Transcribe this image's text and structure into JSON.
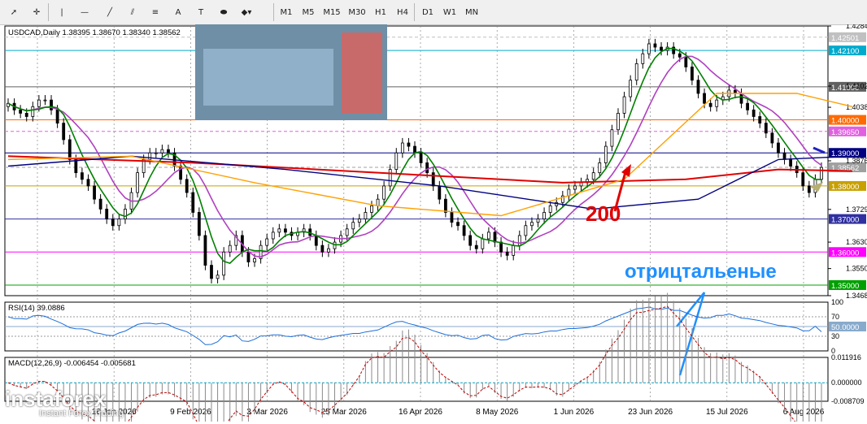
{
  "toolbar": {
    "timeframes": [
      "M1",
      "M5",
      "M15",
      "M30",
      "H1",
      "H4",
      "D1",
      "W1",
      "MN"
    ],
    "tools": [
      {
        "icon": "cursor-icon",
        "glyph": "➚"
      },
      {
        "icon": "crosshair-icon",
        "glyph": "✛"
      },
      {
        "icon": "vertical-line-icon",
        "glyph": "|"
      },
      {
        "icon": "horizontal-line-icon",
        "glyph": "—"
      },
      {
        "icon": "trend-line-icon",
        "glyph": "╱"
      },
      {
        "icon": "equidistant-channel-icon",
        "glyph": "⫽"
      },
      {
        "icon": "fibonacci-icon",
        "glyph": "≡"
      },
      {
        "icon": "text-icon",
        "glyph": "A"
      },
      {
        "icon": "text-label-icon",
        "glyph": "T"
      },
      {
        "icon": "arrows-icon",
        "glyph": "⬬"
      },
      {
        "icon": "objects-dropdown-icon",
        "glyph": "◆▾"
      }
    ]
  },
  "chart_data": {
    "type": "candlestick",
    "symbol_header": "USDCAD,Daily  1.38395 1.38670 1.38340 1.38562",
    "x_labels": [
      "16 Jan 2026",
      "9 Feb 2026",
      "3 Mar 2026",
      "25 Mar 2026",
      "16 Apr 2026",
      "8 May 2026",
      "1 Jun 2026",
      "23 Jun 2026",
      "15 Jul 2026",
      "6 Aug 2026"
    ],
    "price_range": [
      1.3468,
      1.4284
    ],
    "y_ticks": [
      "1.42840",
      "1.41020",
      "1.40380",
      "1.38760",
      "1.37290",
      "1.36300",
      "1.35500",
      "1.34680"
    ],
    "price_levels": [
      {
        "label": "1.42501",
        "value": 1.42501,
        "color": "#c0c0c0",
        "style": "dashed"
      },
      {
        "label": "1.42100",
        "value": 1.421,
        "color": "#00aacc",
        "style": "solid"
      },
      {
        "label": "1.41000",
        "value": 1.41,
        "color": "#606060",
        "style": "solid"
      },
      {
        "label": "1.40000",
        "value": 1.4,
        "color": "#ff6a00",
        "style": "solid"
      },
      {
        "label": "1.39650",
        "value": 1.3965,
        "color": "#e060e0",
        "style": "dashed"
      },
      {
        "label": "1.39000",
        "value": 1.39,
        "color": "#000080",
        "style": "solid"
      },
      {
        "label": "1.38562",
        "value": 1.38562,
        "color": "#a0a0a0",
        "style": "dashed"
      },
      {
        "label": "1.38000",
        "value": 1.38,
        "color": "#c8a000",
        "style": "solid"
      },
      {
        "label": "1.37000",
        "value": 1.37,
        "color": "#3030a0",
        "style": "solid"
      },
      {
        "label": "1.36000",
        "value": 1.36,
        "color": "#ff00ff",
        "style": "solid"
      },
      {
        "label": "1.35000",
        "value": 1.35,
        "color": "#00a000",
        "style": "solid"
      }
    ],
    "closes": [
      1.405,
      1.403,
      1.402,
      1.401,
      1.404,
      1.406,
      1.406,
      1.403,
      1.399,
      1.394,
      1.388,
      1.384,
      1.382,
      1.38,
      1.376,
      1.373,
      1.37,
      1.368,
      1.37,
      1.373,
      1.378,
      1.384,
      1.388,
      1.39,
      1.39,
      1.391,
      1.39,
      1.386,
      1.382,
      1.378,
      1.372,
      1.365,
      1.356,
      1.352,
      1.353,
      1.36,
      1.362,
      1.365,
      1.36,
      1.357,
      1.358,
      1.362,
      1.364,
      1.366,
      1.367,
      1.366,
      1.365,
      1.366,
      1.367,
      1.365,
      1.362,
      1.36,
      1.361,
      1.363,
      1.365,
      1.367,
      1.369,
      1.37,
      1.372,
      1.374,
      1.376,
      1.38,
      1.385,
      1.39,
      1.393,
      1.392,
      1.39,
      1.387,
      1.384,
      1.38,
      1.376,
      1.372,
      1.369,
      1.368,
      1.365,
      1.362,
      1.361,
      1.364,
      1.366,
      1.363,
      1.36,
      1.359,
      1.362,
      1.365,
      1.368,
      1.369,
      1.37,
      1.372,
      1.374,
      1.375,
      1.377,
      1.379,
      1.38,
      1.381,
      1.382,
      1.384,
      1.387,
      1.392,
      1.397,
      1.402,
      1.407,
      1.412,
      1.417,
      1.42,
      1.423,
      1.422,
      1.421,
      1.422,
      1.42,
      1.419,
      1.416,
      1.412,
      1.408,
      1.405,
      1.404,
      1.406,
      1.407,
      1.409,
      1.408,
      1.405,
      1.403,
      1.401,
      1.399,
      1.396,
      1.393,
      1.39,
      1.388,
      1.386,
      1.384,
      1.38,
      1.378,
      1.382,
      1.3856
    ],
    "lines": [
      {
        "name": "ma-200",
        "color": "#e00000",
        "points": [
          [
            0,
            1.389
          ],
          [
            30,
            1.387
          ],
          [
            60,
            1.384
          ],
          [
            90,
            1.381
          ],
          [
            110,
            1.382
          ],
          [
            125,
            1.385
          ],
          [
            137,
            1.3845
          ]
        ]
      },
      {
        "name": "ma-100",
        "color": "#000080",
        "points": [
          [
            0,
            1.386
          ],
          [
            20,
            1.389
          ],
          [
            45,
            1.385
          ],
          [
            70,
            1.38
          ],
          [
            95,
            1.373
          ],
          [
            112,
            1.376
          ],
          [
            125,
            1.388
          ],
          [
            137,
            1.389
          ]
        ]
      },
      {
        "name": "ma-50",
        "color": "#ffa000",
        "points": [
          [
            0,
            1.388
          ],
          [
            20,
            1.389
          ],
          [
            40,
            1.381
          ],
          [
            60,
            1.374
          ],
          [
            80,
            1.371
          ],
          [
            100,
            1.382
          ],
          [
            115,
            1.408
          ],
          [
            128,
            1.408
          ],
          [
            137,
            1.404
          ]
        ]
      }
    ],
    "annotations": [
      {
        "text": "200",
        "color": "#e00000"
      },
      {
        "text": "отрицтальеные",
        "color": "#1e90ff"
      }
    ],
    "rsi": {
      "label": "RSI(14) 39.0886",
      "ticks": [
        "100",
        "70",
        "30",
        "0"
      ],
      "level_label": "50.0000",
      "value": 39.0886
    },
    "macd": {
      "label": "MACD(12,26,9) -0.006454 -0.005681",
      "ticks": [
        "0.011916",
        "0.000000",
        "-0.008709"
      ],
      "macd": -0.006454,
      "signal": -0.005681
    },
    "watermark": {
      "brand": "instaforex",
      "tagline": "Instant Forex Trading"
    }
  }
}
